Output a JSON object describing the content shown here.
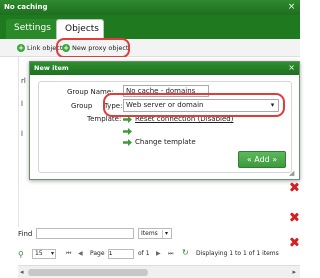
{
  "outer_dialog": {
    "title": "No caching",
    "close_glyph": "×",
    "tabs": [
      {
        "label": "Settings",
        "active": false
      },
      {
        "label": "Objects",
        "active": true
      }
    ],
    "toolbar": {
      "link_object_label": "Link object",
      "new_proxy_label": "New proxy object",
      "icon": "plus-circle-icon"
    },
    "list_labels": [
      "rl",
      "l",
      "l"
    ],
    "find": {
      "label": "Find",
      "value": "",
      "field_select": "Items"
    },
    "pager": {
      "page_size": "15",
      "page_label": "Page",
      "page_value": "1",
      "of_label": "of 1",
      "status": "Displaying 1 to 1 of 1 items"
    }
  },
  "new_item_dialog": {
    "title": "New item",
    "close_glyph": "×",
    "group_name_label": "Group Name:",
    "group_name_value": "No cache - domains",
    "group_label": "Group",
    "type_label": "Type:",
    "type_value": "Web server or domain",
    "template_label": "Template:",
    "reset_connection_label": "Reset connection (Disabled)",
    "change_template_label": "Change template",
    "add_button_label": "« Add »"
  },
  "colors": {
    "titlebar_green": "#1f7a1f",
    "accent_green": "#3c9a3c",
    "annotation_red": "#e03c3c",
    "delete_red": "#d62020"
  }
}
